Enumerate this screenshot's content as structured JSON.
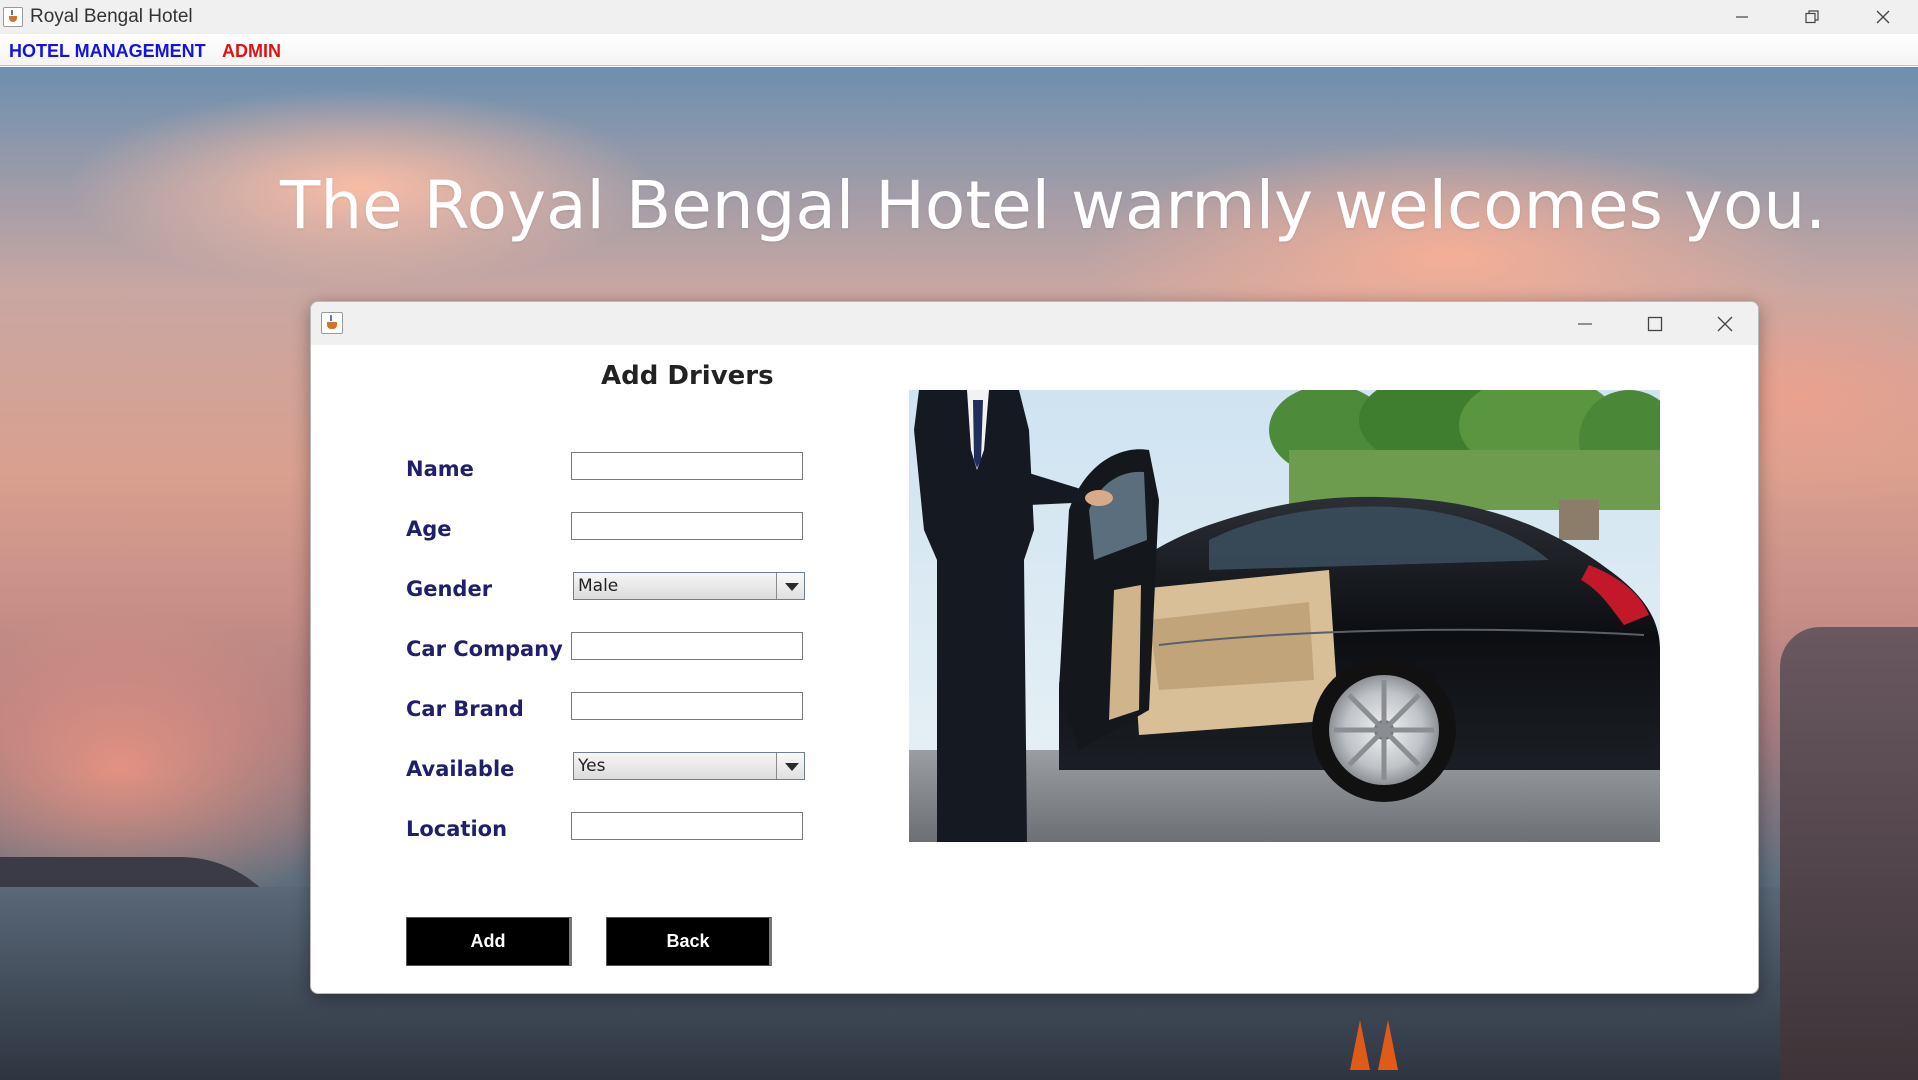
{
  "window": {
    "title": "Royal Bengal Hotel",
    "controls": {
      "minimize": "minimize-icon",
      "restore": "restore-icon",
      "close": "close-icon"
    }
  },
  "menu": {
    "items": [
      {
        "label": "HOTEL MANAGEMENT",
        "color": "#1414e0"
      },
      {
        "label": "ADMIN",
        "color": "#e01414"
      }
    ]
  },
  "banner": {
    "welcome_text": "The Royal Bengal Hotel warmly welcomes you."
  },
  "dialog": {
    "heading": "Add Drivers",
    "fields": {
      "name": {
        "label": "Name",
        "value": ""
      },
      "age": {
        "label": "Age",
        "value": ""
      },
      "gender": {
        "label": "Gender",
        "selected": "Male"
      },
      "car_company": {
        "label": "Car Company",
        "value": ""
      },
      "car_brand": {
        "label": "Car Brand",
        "value": ""
      },
      "available": {
        "label": "Available",
        "selected": "Yes"
      },
      "location": {
        "label": "Location",
        "value": ""
      }
    },
    "buttons": {
      "add": "Add",
      "back": "Back"
    },
    "photo_icon": "chauffeur-car-photo"
  },
  "colors": {
    "label_text": "#1f1f6b",
    "button_bg": "#000000",
    "button_text": "#ffffff"
  }
}
